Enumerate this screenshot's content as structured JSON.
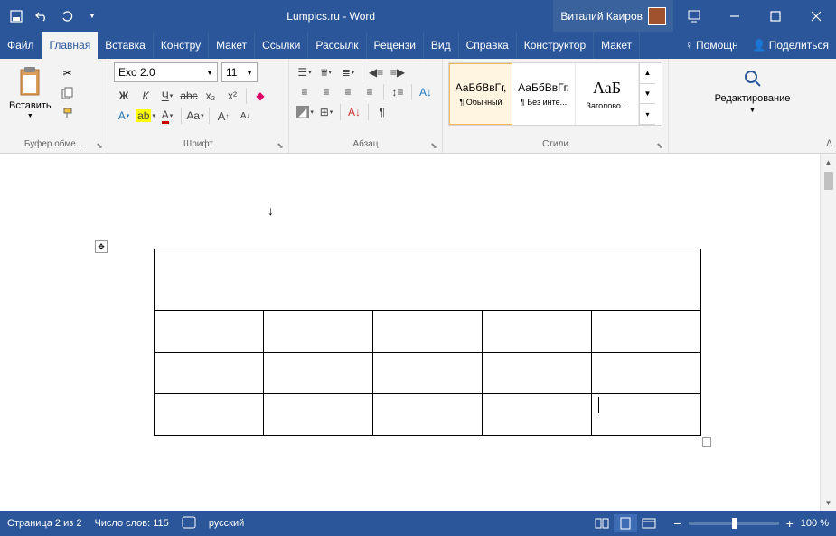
{
  "titlebar": {
    "title": "Lumpics.ru - Word",
    "user": "Виталий Каиров"
  },
  "tabs": {
    "file": "Файл",
    "home": "Главная",
    "insert": "Вставка",
    "design": "Констру",
    "layout": "Макет",
    "references": "Ссылки",
    "mailings": "Рассылк",
    "review": "Рецензи",
    "view": "Вид",
    "help": "Справка",
    "table_design": "Конструктор",
    "table_layout": "Макет",
    "help_btn": "Помощн",
    "share": "Поделиться"
  },
  "ribbon": {
    "clipboard": {
      "paste": "Вставить",
      "label": "Буфер обме..."
    },
    "font": {
      "name": "Exo 2.0",
      "size": "11",
      "bold": "Ж",
      "italic": "К",
      "underline": "Ч",
      "strike": "abc",
      "sub": "x₂",
      "sup": "x²",
      "label": "Шрифт"
    },
    "paragraph": {
      "label": "Абзац"
    },
    "styles": {
      "normal_preview": "АаБбВвГг,",
      "normal_label": "¶ Обычный",
      "nospacing_preview": "АаБбВвГг,",
      "nospacing_label": "¶ Без инте...",
      "heading_preview": "АаБ",
      "heading_label": "Заголово...",
      "label": "Стили"
    },
    "editing": {
      "label": "Редактирование"
    }
  },
  "statusbar": {
    "page": "Страница 2 из 2",
    "words": "Число слов: 115",
    "language": "русский",
    "zoom": "100 %"
  }
}
